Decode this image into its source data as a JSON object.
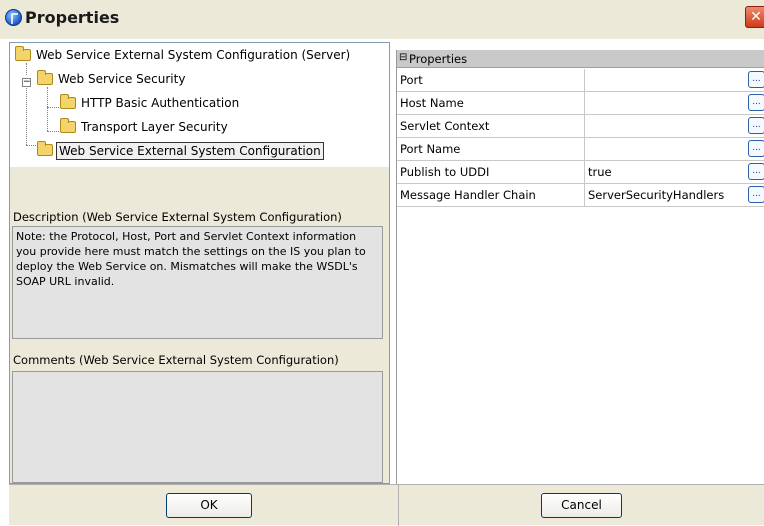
{
  "window": {
    "title": "Properties",
    "close_label": "✕"
  },
  "tree": {
    "root": "Web Service External System Configuration (Server)",
    "security": "Web Service Security",
    "http_auth": "HTTP Basic Authentication",
    "transport": "Transport Layer Security",
    "config": "Web Service External System Configuration",
    "expander_symbol": "−"
  },
  "description": {
    "label": "Description (Web Service External System Configuration)",
    "text": "Note: the Protocol, Host, Port and Servlet Context information you provide here must match the settings on the IS you plan to deploy the Web Service on. Mismatches will make the WSDL's SOAP URL invalid."
  },
  "comments": {
    "label": "Comments (Web Service External System Configuration)",
    "text": ""
  },
  "properties": {
    "header": "Properties",
    "collapse_symbol": "⊟",
    "rows": [
      {
        "name": "Port",
        "value": ""
      },
      {
        "name": "Host Name",
        "value": ""
      },
      {
        "name": "Servlet Context",
        "value": ""
      },
      {
        "name": "Port Name",
        "value": ""
      },
      {
        "name": "Publish to UDDI",
        "value": "true"
      },
      {
        "name": "Message Handler Chain",
        "value": "ServerSecurityHandlers"
      }
    ],
    "ellipsis": "..."
  },
  "buttons": {
    "ok": "OK",
    "cancel": "Cancel"
  },
  "colors": {
    "window_bg": "#ece9d8",
    "header_bg": "#c9c9c9",
    "accent": "#003c74"
  }
}
